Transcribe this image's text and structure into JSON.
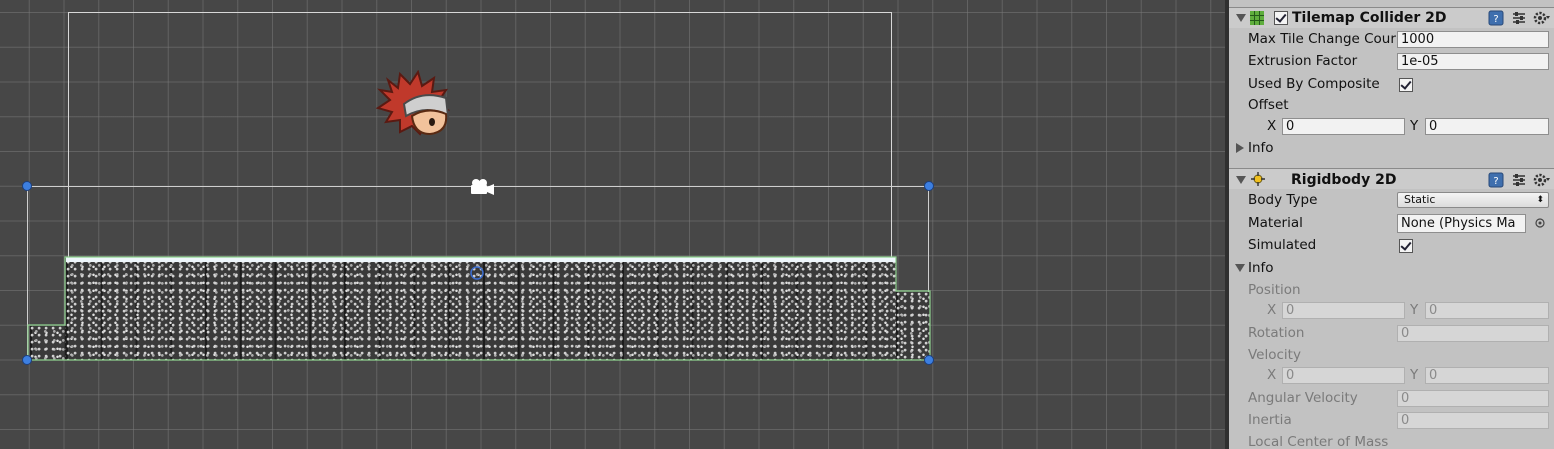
{
  "inspector": {
    "tilemap_collider": {
      "title": "Tilemap Collider 2D",
      "max_tile_change_label": "Max Tile Change Cour",
      "max_tile_change_value": "1000",
      "extrusion_label": "Extrusion Factor",
      "extrusion_value": "1e-05",
      "used_by_composite_label": "Used By Composite",
      "offset_label": "Offset",
      "offset_x_label": "X",
      "offset_x_value": "0",
      "offset_y_label": "Y",
      "offset_y_value": "0",
      "info_label": "Info"
    },
    "rigidbody": {
      "title": "Rigidbody 2D",
      "body_type_label": "Body Type",
      "body_type_value": "Static",
      "material_label": "Material",
      "material_value": "None (Physics Ma",
      "simulated_label": "Simulated",
      "info_label": "Info",
      "position_label": "Position",
      "position_x_label": "X",
      "position_x_value": "0",
      "position_y_label": "Y",
      "position_y_value": "0",
      "rotation_label": "Rotation",
      "rotation_value": "0",
      "velocity_label": "Velocity",
      "velocity_x_label": "X",
      "velocity_x_value": "0",
      "velocity_y_label": "Y",
      "velocity_y_value": "0",
      "angular_velocity_label": "Angular Velocity",
      "angular_velocity_value": "0",
      "inertia_label": "Inertia",
      "inertia_value": "0",
      "local_com_label": "Local Center of Mass"
    }
  },
  "scene": {
    "icons": [
      "player-character-sprite",
      "camera-gizmo-icon",
      "pivot-icon"
    ]
  },
  "colors": {
    "scene_bg": "#474747",
    "grid_line": "#6e6e6e",
    "inspector_bg": "#c2c2c2",
    "handle_blue": "#3d7fe0",
    "collider_green": "#8fd28f"
  }
}
